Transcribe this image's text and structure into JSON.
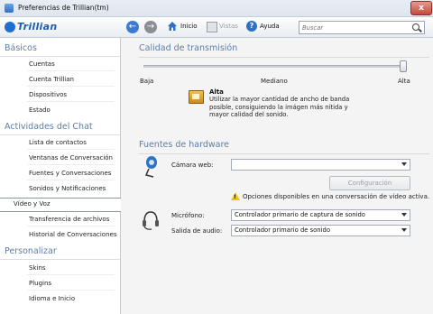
{
  "window": {
    "title": "Preferencias de Trillian(tm)",
    "close_glyph": "x"
  },
  "toolbar": {
    "logo_text": "Trillian",
    "home_label": "Inicio",
    "vistas_label": "Vistas",
    "help_label": "Ayuda",
    "search_placeholder": "Buscar"
  },
  "sidebar": {
    "sections": [
      {
        "title": "Básicos",
        "items": [
          "Cuentas",
          "Cuenta Trillian",
          "Dispositivos",
          "Estado"
        ]
      },
      {
        "title": "Actividades del Chat",
        "items": [
          "Lista de contactos",
          "Ventanas de Conversación",
          "Fuentes y Conversaciones",
          "Sonidos y Notificaciones",
          "Vídeo y Voz",
          "Transferencia de archivos",
          "Historial de Conversaciones"
        ]
      },
      {
        "title": "Personalizar",
        "items": [
          "Skins",
          "Plugins",
          "Idioma e Inicio"
        ]
      }
    ],
    "selected": "Vídeo y Voz"
  },
  "transmission": {
    "title": "Calidad de transmisión",
    "low_label": "Baja",
    "mid_label": "Mediano",
    "high_label": "Alta",
    "level": 1.0,
    "quality_title": "Alta",
    "quality_desc": "Utilizar la mayor cantidad de ancho de banda posible, consiguiendo la imágen más nítida y mayor calidad del sonido."
  },
  "hardware": {
    "title": "Fuentes de hardware",
    "camera_label": "Cámara web:",
    "camera_value": "",
    "config_button": "Configuración",
    "warning_text": "Opciones disponibles en una conversación de vídeo activa.",
    "mic_label": "Micrófono:",
    "mic_value": "Controlador primario de captura de sonido",
    "audio_out_label": "Salida de audio:",
    "audio_out_value": "Controlador primario de sonido"
  },
  "colors": {
    "accent": "#5e7da6",
    "brand": "#1d5eb5"
  }
}
